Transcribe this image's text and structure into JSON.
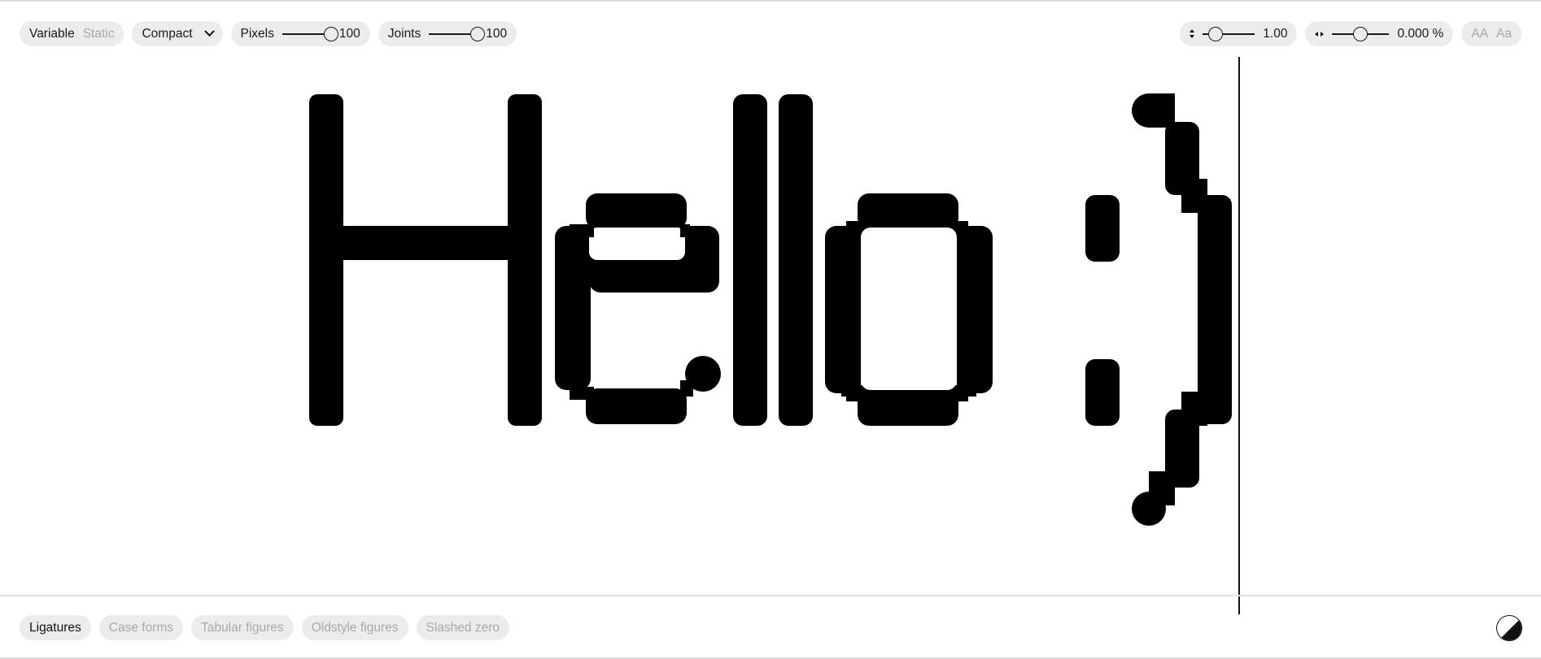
{
  "top_toolbar": {
    "mode_variable": "Variable",
    "mode_static": "Static",
    "width_select": "Compact",
    "pixels": {
      "label": "Pixels",
      "value": "100",
      "fraction": 1.0
    },
    "joints": {
      "label": "Joints",
      "value": "100",
      "fraction": 1.0
    }
  },
  "right_toolbar": {
    "line_height": {
      "value": "1.00",
      "fraction": 0.25
    },
    "letter_spacing": {
      "value": "0.000 %",
      "fraction": 0.5
    },
    "case_upper": "AA",
    "case_title": "Aa"
  },
  "preview": {
    "text": "Hello :)"
  },
  "bottom_toolbar": {
    "features": [
      {
        "label": "Ligatures",
        "active": true
      },
      {
        "label": "Case forms",
        "active": false
      },
      {
        "label": "Tabular figures",
        "active": false
      },
      {
        "label": "Oldstyle figures",
        "active": false
      },
      {
        "label": "Slashed zero",
        "active": false
      }
    ]
  },
  "theme": {
    "icon": "contrast-icon"
  }
}
